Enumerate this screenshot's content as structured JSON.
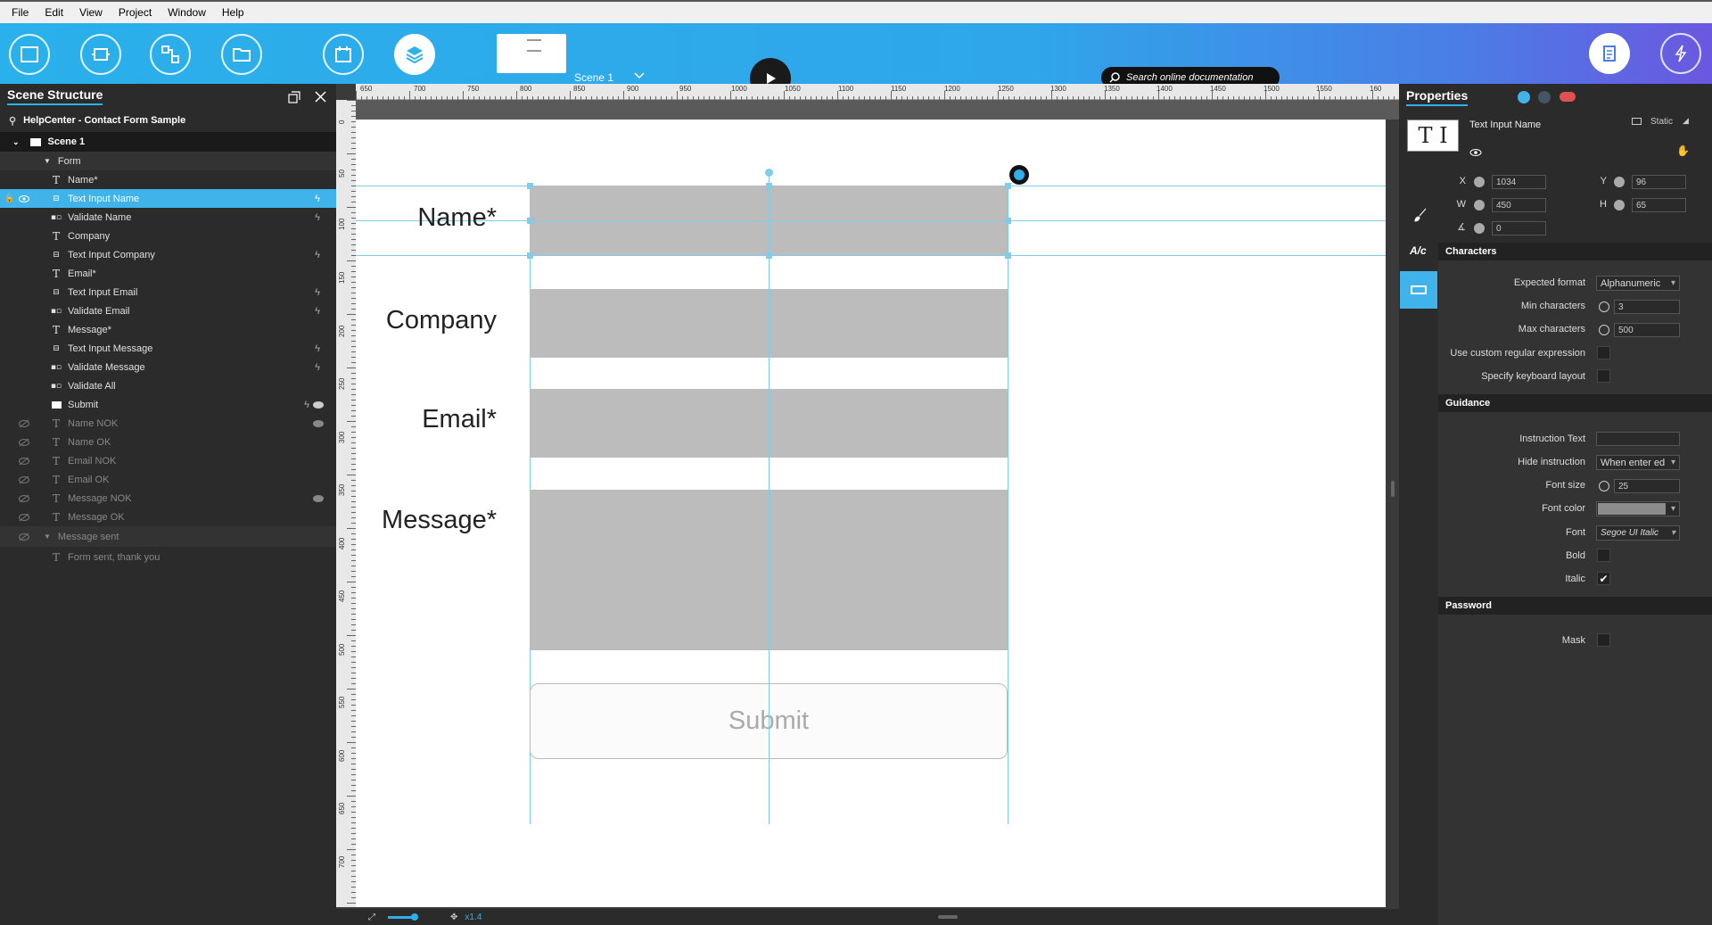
{
  "menu": [
    "File",
    "Edit",
    "View",
    "Project",
    "Window",
    "Help"
  ],
  "toolbar": {
    "scene_name": "Scene 1",
    "scene_badge": "1",
    "search_placeholder": "Search online documentation"
  },
  "scene_structure": {
    "title": "Scene Structure",
    "project": "HelpCenter - Contact Form Sample",
    "scene": "Scene 1",
    "group_form": "Form",
    "items": [
      {
        "icon": "T",
        "label": "Name*"
      },
      {
        "icon": "input",
        "label": "Text Input Name"
      },
      {
        "icon": "validate",
        "label": "Validate Name"
      },
      {
        "icon": "T",
        "label": "Company"
      },
      {
        "icon": "input",
        "label": "Text Input Company"
      },
      {
        "icon": "T",
        "label": "Email*"
      },
      {
        "icon": "input",
        "label": "Text Input Email"
      },
      {
        "icon": "validate",
        "label": "Validate Email"
      },
      {
        "icon": "T",
        "label": "Message*"
      },
      {
        "icon": "input",
        "label": "Text Input Message"
      },
      {
        "icon": "validate",
        "label": "Validate Message"
      },
      {
        "icon": "validate",
        "label": "Validate All"
      },
      {
        "icon": "button",
        "label": "Submit"
      },
      {
        "icon": "T",
        "label": "Name NOK"
      },
      {
        "icon": "T",
        "label": "Name OK"
      },
      {
        "icon": "T",
        "label": "Email NOK"
      },
      {
        "icon": "T",
        "label": "Email OK"
      },
      {
        "icon": "T",
        "label": "Message NOK"
      },
      {
        "icon": "T",
        "label": "Message OK"
      }
    ],
    "group_message_sent": "Message sent",
    "message_sent_item": "Form sent, thank you"
  },
  "ruler_top": [
    "650",
    "700",
    "750",
    "800",
    "850",
    "900",
    "950",
    "1000",
    "1050",
    "1100",
    "1150",
    "1200",
    "1250",
    "1300",
    "1350",
    "1400",
    "1450",
    "1500",
    "1550",
    "160"
  ],
  "ruler_left": [
    "0",
    "50",
    "100",
    "150",
    "200",
    "250",
    "300",
    "350",
    "400",
    "450",
    "500",
    "550",
    "600",
    "650",
    "700"
  ],
  "canvas": {
    "labels": {
      "name": "Name*",
      "company": "Company",
      "email": "Email*",
      "message": "Message*"
    },
    "submit": "Submit"
  },
  "status": {
    "zoom": "x1.4"
  },
  "properties": {
    "title": "Properties",
    "element_name": "Text Input Name",
    "mode": "Static",
    "x_label": "X",
    "x": "1034",
    "y_label": "Y",
    "y": "96",
    "w_label": "W",
    "w": "450",
    "h_label": "H",
    "h": "65",
    "angle": "0",
    "characters_head": "Characters",
    "expected_format_label": "Expected format",
    "expected_format": "Alphanumeric",
    "min_chars_label": "Min characters",
    "min_chars": "3",
    "max_chars_label": "Max characters",
    "max_chars": "500",
    "custom_regex_label": "Use custom regular expression",
    "keyboard_label": "Specify keyboard layout",
    "guidance_head": "Guidance",
    "instruction_label": "Instruction Text",
    "hide_instruction_label": "Hide instruction",
    "hide_instruction": "When enter ed",
    "font_size_label": "Font size",
    "font_size": "25",
    "font_color_label": "Font color",
    "font_label": "Font",
    "font": "Segoe UI Italic",
    "bold_label": "Bold",
    "italic_label": "Italic",
    "italic_check": "✔",
    "password_head": "Password",
    "mask_label": "Mask"
  },
  "colors": {
    "accent": "#2fb0ea",
    "selection": "#3fb3ea",
    "input_fill": "#bcbcbc"
  }
}
